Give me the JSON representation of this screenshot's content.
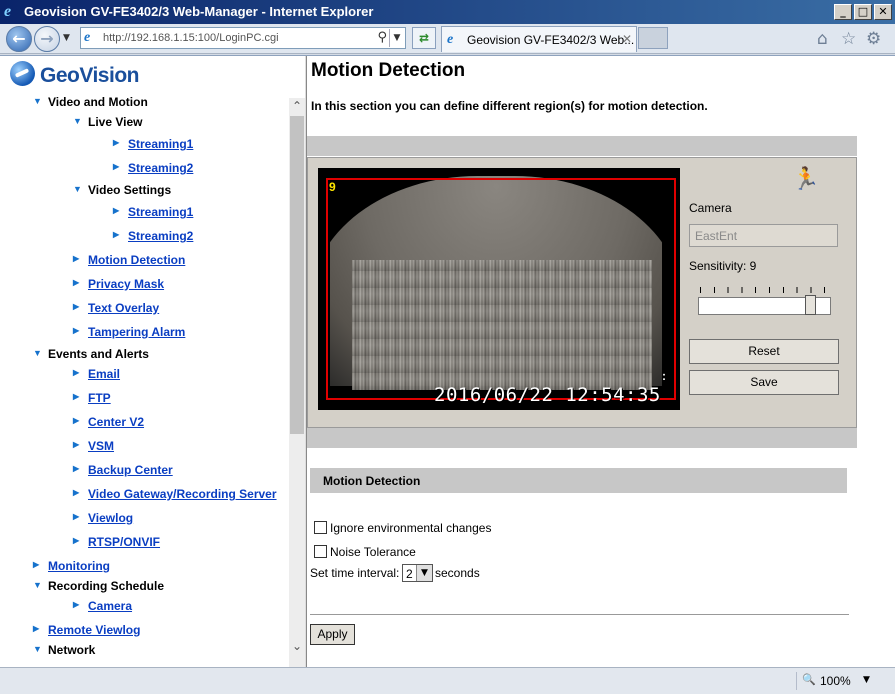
{
  "window": {
    "title": "Geovision GV-FE3402/3 Web-Manager - Internet Explorer",
    "min_glyph": "_",
    "max_glyph": "□",
    "close_glyph": "✕"
  },
  "browser": {
    "address_url": "http://192.168.1.15:100/LoginPC.cgi",
    "tab_title": "Geovision GV-FE3402/3 Web...",
    "zoom": "100%"
  },
  "sidebar": {
    "logo_text": "GeoVision",
    "items": [
      {
        "label": "Video and Motion",
        "type": "head",
        "expanded": true,
        "level": 0
      },
      {
        "label": "Live View",
        "type": "head",
        "expanded": true,
        "level": 1
      },
      {
        "label": "Streaming1",
        "type": "link",
        "level": 2
      },
      {
        "label": "Streaming2",
        "type": "link",
        "level": 2
      },
      {
        "label": "Video Settings",
        "type": "head",
        "expanded": true,
        "level": 1
      },
      {
        "label": "Streaming1",
        "type": "link",
        "level": 2
      },
      {
        "label": "Streaming2",
        "type": "link",
        "level": 2
      },
      {
        "label": "Motion Detection",
        "type": "link",
        "level": 1
      },
      {
        "label": "Privacy Mask",
        "type": "link",
        "level": 1
      },
      {
        "label": "Text Overlay",
        "type": "link",
        "level": 1
      },
      {
        "label": "Tampering Alarm",
        "type": "link",
        "level": 1
      },
      {
        "label": "Events and Alerts",
        "type": "head",
        "expanded": true,
        "level": 0
      },
      {
        "label": "Email",
        "type": "link",
        "level": 1
      },
      {
        "label": "FTP",
        "type": "link",
        "level": 1
      },
      {
        "label": "Center V2",
        "type": "link",
        "level": 1
      },
      {
        "label": "VSM",
        "type": "link",
        "level": 1
      },
      {
        "label": "Backup Center",
        "type": "link",
        "level": 1
      },
      {
        "label": "Video Gateway/Recording Server",
        "type": "link",
        "level": 1
      },
      {
        "label": "Viewlog",
        "type": "link",
        "level": 1
      },
      {
        "label": "RTSP/ONVIF",
        "type": "link",
        "level": 1
      },
      {
        "label": "Monitoring",
        "type": "link",
        "level": 0
      },
      {
        "label": "Recording Schedule",
        "type": "head",
        "expanded": true,
        "level": 0
      },
      {
        "label": "Camera",
        "type": "link",
        "level": 1
      },
      {
        "label": "Remote Viewlog",
        "type": "link",
        "level": 0
      },
      {
        "label": "Network",
        "type": "head",
        "expanded": true,
        "level": 0
      }
    ]
  },
  "main": {
    "title": "Motion Detection",
    "intro": "In this section you can define different region(s) for motion detection.",
    "video": {
      "region_number": "9",
      "timestamp": "2016/06/22 12:54:35",
      "colon_mark": ":"
    },
    "camera_label": "Camera",
    "camera_value": "EastEnt",
    "sensitivity_label": "Sensitivity: 9",
    "sensitivity_value": 9,
    "sensitivity_max": 10,
    "reset_label": "Reset",
    "save_label": "Save",
    "section_title": "Motion Detection",
    "options": [
      {
        "label": "Ignore environmental changes",
        "checked": false
      },
      {
        "label": "Noise Tolerance",
        "checked": false
      }
    ],
    "interval_label": "Set time interval:",
    "interval_value": "2",
    "interval_unit": "seconds",
    "apply_label": "Apply"
  }
}
